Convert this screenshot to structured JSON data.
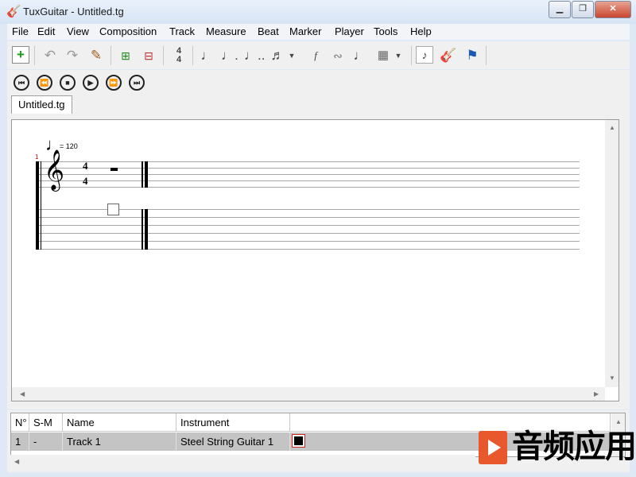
{
  "window": {
    "title": "TuxGuitar - Untitled.tg",
    "icons": [
      "app-icon",
      "minimize-icon",
      "maximize-icon",
      "close-icon"
    ]
  },
  "menu": [
    "File",
    "Edit",
    "View",
    "Composition",
    "Track",
    "Measure",
    "Beat",
    "Marker",
    "Player",
    "Tools",
    "Help"
  ],
  "toolbar": {
    "icons": [
      "new-file-icon",
      "undo-icon",
      "redo-icon",
      "edit-mode-icon",
      "add-measure-icon",
      "remove-measure-icon",
      "time-signature-icon",
      "quarter-note-icon",
      "dotted-note-icon",
      "double-dotted-note-icon",
      "tuplet-icon",
      "dynamics-icon",
      "effects-icon",
      "tie-icon",
      "chord-icon",
      "note-view-icon",
      "fretboard-icon",
      "marker-flag-icon"
    ]
  },
  "transport": {
    "icons": [
      "first-icon",
      "previous-icon",
      "stop-icon",
      "play-icon",
      "next-icon",
      "last-icon"
    ]
  },
  "tabs": [
    {
      "label": "Untitled.tg"
    }
  ],
  "score": {
    "measure_number": "1",
    "tempo": "= 120",
    "time_signature_top": "4",
    "time_signature_bottom": "4"
  },
  "tracks_table": {
    "headers": [
      "N°",
      "S-M",
      "Name",
      "Instrument"
    ],
    "rows": [
      {
        "num": "1",
        "sm": "-",
        "name": "Track 1",
        "instrument": "Steel String Guitar 1",
        "color": "#000000"
      }
    ]
  },
  "watermark": {
    "text": "音频应用"
  }
}
